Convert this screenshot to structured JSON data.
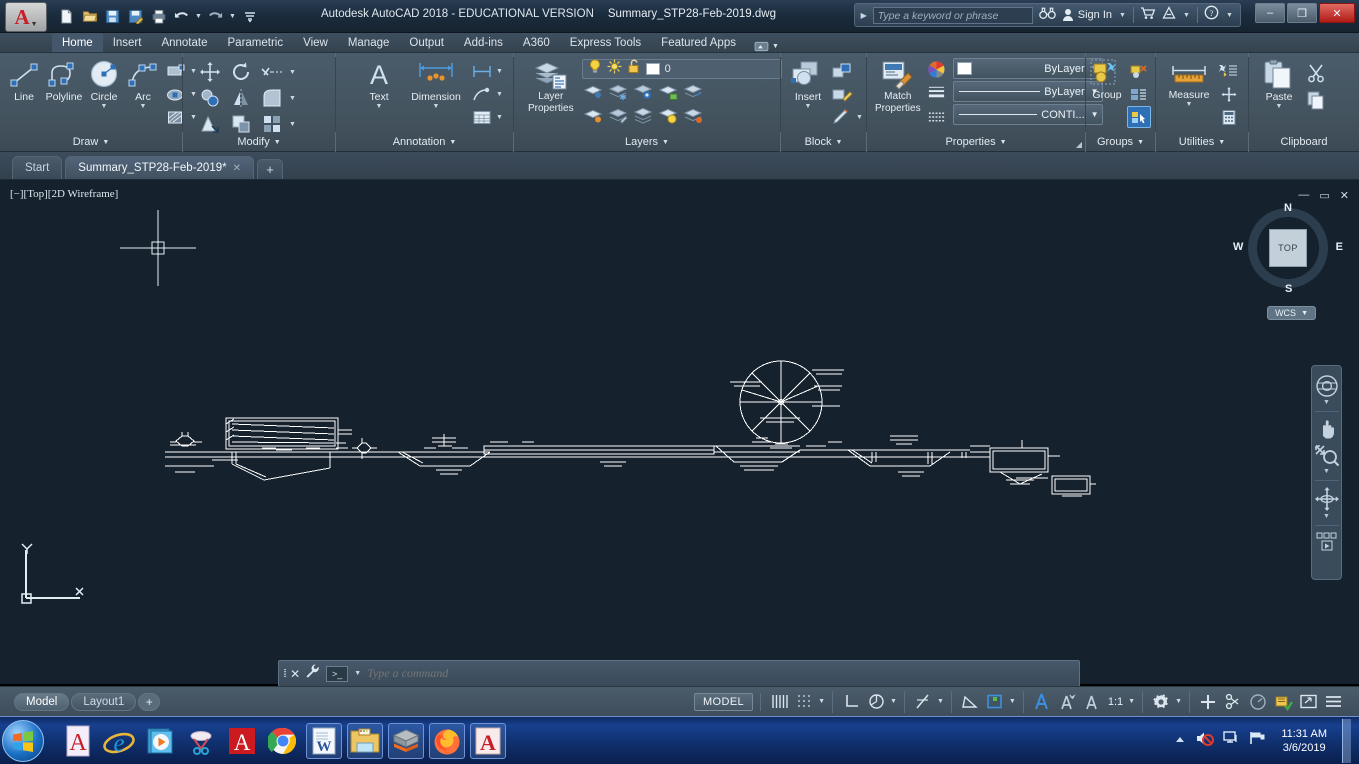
{
  "window": {
    "app_title": "Autodesk AutoCAD 2018 - EDUCATIONAL VERSION",
    "file_name": "Summary_STP28-Feb-2019.dwg",
    "minimize": "–",
    "maximize": "❐",
    "close": "✕"
  },
  "quick_access": [
    {
      "name": "new-icon",
      "label": "New"
    },
    {
      "name": "open-icon",
      "label": "Open"
    },
    {
      "name": "save-icon",
      "label": "Save"
    },
    {
      "name": "saveas-icon",
      "label": "Save As"
    },
    {
      "name": "plot-icon",
      "label": "Plot"
    },
    {
      "name": "undo-icon",
      "label": "Undo"
    },
    {
      "name": "redo-icon",
      "label": "Redo"
    },
    {
      "name": "qat-more-icon",
      "label": "Customize"
    }
  ],
  "infocenter": {
    "search_placeholder": "Type a keyword or phrase",
    "sign_in": "Sign In",
    "icons": [
      "binoculars-icon",
      "user-icon",
      "cart-icon",
      "autodesk-icon",
      "help-icon"
    ]
  },
  "ribbon": {
    "tabs": [
      {
        "label": "Home",
        "active": true
      },
      {
        "label": "Insert",
        "active": false
      },
      {
        "label": "Annotate",
        "active": false
      },
      {
        "label": "Parametric",
        "active": false
      },
      {
        "label": "View",
        "active": false
      },
      {
        "label": "Manage",
        "active": false
      },
      {
        "label": "Output",
        "active": false
      },
      {
        "label": "Add-ins",
        "active": false
      },
      {
        "label": "A360",
        "active": false
      },
      {
        "label": "Express Tools",
        "active": false
      },
      {
        "label": "Featured Apps",
        "active": false
      }
    ],
    "panels": {
      "draw": {
        "title": "Draw",
        "line": "Line",
        "polyline": "Polyline",
        "circle": "Circle",
        "arc": "Arc",
        "small_icons": [
          "rectangle-icon",
          "ellipse-icon",
          "hatch-icon"
        ]
      },
      "modify": {
        "title": "Modify",
        "small_icons": [
          "move-icon",
          "rotate-icon",
          "trim-icon",
          "copy-icon",
          "mirror-icon",
          "fillet-icon",
          "stretch-icon",
          "scale-icon",
          "array-icon"
        ]
      },
      "annotation": {
        "title": "Annotation",
        "text": "Text",
        "dimension": "Dimension",
        "small_icons": [
          "linear-dim-icon",
          "leader-icon",
          "table-icon"
        ]
      },
      "layers": {
        "title": "Layers",
        "layer_properties": "Layer\nProperties",
        "current_layer": "0",
        "state_icons": [
          "lightbulb-icon",
          "sun-icon",
          "unlock-icon"
        ],
        "small_icons": [
          "layer-isolate-icon",
          "layer-freeze-icon",
          "layer-off-icon",
          "layer-unlock-icon",
          "layer-match-icon",
          "layer-previous-icon",
          "layer-change-icon",
          "layer-on-icon",
          "layer-lock-icon",
          "layer-merge-icon"
        ]
      },
      "block": {
        "title": "Block",
        "insert": "Insert",
        "small_icons": [
          "create-block-icon",
          "edit-block-icon",
          "edit-attribute-icon"
        ]
      },
      "properties": {
        "title": "Properties",
        "match_properties": "Match\nProperties",
        "color": "ByLayer",
        "lineweight": "ByLayer",
        "linetype": "CONTI...",
        "side_icons": [
          "color-wheel-icon",
          "lineweight-icon",
          "linetype-icon"
        ]
      },
      "groups": {
        "title": "Groups",
        "group": "Group",
        "small_icons": [
          "ungroup-icon",
          "group-edit-icon",
          "group-selection-icon"
        ]
      },
      "utilities": {
        "title": "Utilities",
        "measure": "Measure",
        "small_icons": [
          "quick-select-icon",
          "point-id-icon",
          "calculator-icon"
        ]
      },
      "clipboard": {
        "title": "Clipboard",
        "paste": "Paste",
        "small_icons": [
          "cut-icon",
          "copy-icon"
        ]
      }
    }
  },
  "file_tabs": [
    {
      "label": "Start",
      "active": false,
      "closable": false
    },
    {
      "label": "Summary_STP28-Feb-2019*",
      "active": true,
      "closable": true
    }
  ],
  "file_tab_add": "+",
  "viewport": {
    "label": "[−][Top][2D Wireframe]",
    "controls": [
      "minimize-icon",
      "restore-icon",
      "close-icon"
    ],
    "viewcube": {
      "face": "TOP",
      "north": "N",
      "south": "S",
      "east": "E",
      "west": "W",
      "wcs": "WCS"
    },
    "navbar_icons": [
      "steering-wheel-icon",
      "pan-icon",
      "zoom-icon",
      "orbit-icon",
      "show-motion-icon"
    ],
    "ucs": {
      "x": "X",
      "y": "Y"
    }
  },
  "command_line": {
    "placeholder": "Type a command",
    "value": "",
    "close_label": "✕",
    "settings_icon": "wrench-icon",
    "prompt_icon": ">_"
  },
  "layout_tabs": [
    {
      "label": "Model",
      "active": true
    },
    {
      "label": "Layout1",
      "active": false
    }
  ],
  "layout_add": "+",
  "status_bar": {
    "model_button": "MODEL",
    "scale": "1:1",
    "groups": [
      {
        "name": "display-group",
        "icons": [
          "grid-display-icon",
          "snap-mode-icon"
        ]
      },
      {
        "name": "ortho-group",
        "icons": [
          "ortho-mode-icon",
          "polar-tracking-icon"
        ]
      },
      {
        "name": "osnap-group",
        "icons": [
          "object-snap-tracking-icon",
          "osnap-icon"
        ]
      },
      {
        "name": "ucs-group",
        "icons": [
          "angle-icon",
          "selection-cycling-icon"
        ]
      },
      {
        "name": "annotation-group",
        "icons": [
          "annotation-visibility-icon",
          "autoscale-icon",
          "annotation-scale-icon"
        ]
      },
      {
        "name": "workspace-group",
        "icons": [
          "workspace-gear-icon"
        ]
      },
      {
        "name": "custom-group",
        "icons": [
          "customization-plus-icon",
          "isolate-objects-icon",
          "graphics-performance-icon",
          "hardware-icon",
          "clean-screen-icon",
          "menu-icon"
        ]
      }
    ]
  },
  "taskbar": {
    "start": "start-orb-icon",
    "pinned": [
      {
        "name": "adobe-reader-icon",
        "glyph": "A",
        "color": "#c8202a",
        "bg": "#f4eef8"
      },
      {
        "name": "internet-explorer-icon",
        "glyph": "e",
        "color": "#1e9ad6",
        "bg": "transparent"
      },
      {
        "name": "windows-media-player-icon",
        "glyph": "▶",
        "color": "#ff8c00",
        "bg": "#3a9bd8"
      },
      {
        "name": "snipping-tool-icon",
        "glyph": "✂",
        "color": "#29a3d4",
        "bg": "transparent"
      },
      {
        "name": "acrobat-icon",
        "glyph": "A",
        "color": "#ffffff",
        "bg": "#cc1b20"
      },
      {
        "name": "chrome-icon",
        "glyph": "●",
        "color": "#4285f4",
        "bg": "transparent"
      }
    ],
    "running": [
      {
        "name": "word-icon",
        "glyph": "W",
        "color": "#2b579a",
        "bg": "#f2f6fb"
      },
      {
        "name": "file-explorer-icon",
        "glyph": "🗀",
        "color": "#e8b33c",
        "bg": "transparent"
      },
      {
        "name": "sketchup-icon",
        "glyph": "▣",
        "color": "#9aa0a6",
        "bg": "transparent"
      },
      {
        "name": "firefox-icon",
        "glyph": "●",
        "color": "#ff7139",
        "bg": "transparent"
      },
      {
        "name": "autocad-icon",
        "glyph": "A",
        "color": "#c8202a",
        "bg": "#f6eceb"
      }
    ],
    "tray_icons": [
      "show-hidden-icon",
      "volume-muted-icon",
      "network-icon",
      "action-center-icon"
    ],
    "clock_time": "11:31 AM",
    "clock_date": "3/6/2019"
  },
  "drawing": {
    "description": "Sewage treatment plant longitudinal profile / plan layout, white lines on dark blue",
    "line_color": "#ffffff",
    "background": "#15212c"
  }
}
